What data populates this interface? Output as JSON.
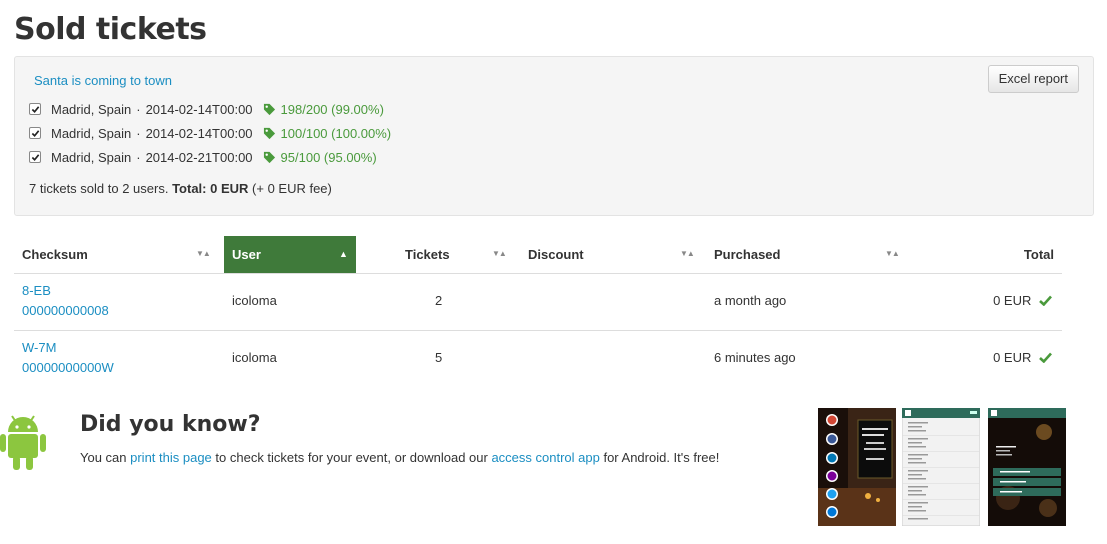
{
  "page": {
    "title": "Sold tickets"
  },
  "event": {
    "name": "Santa is coming to town",
    "excel_button": "Excel report",
    "sessions": [
      {
        "checked": true,
        "location": "Madrid, Spain",
        "separator": "·",
        "datetime": "2014-02-14T00:00",
        "sold": "198/200 (99.00%)"
      },
      {
        "checked": true,
        "location": "Madrid, Spain",
        "separator": "·",
        "datetime": "2014-02-14T00:00",
        "sold": "100/100 (100.00%)"
      },
      {
        "checked": true,
        "location": "Madrid, Spain",
        "separator": "·",
        "datetime": "2014-02-21T00:00",
        "sold": "95/100 (95.00%)"
      }
    ],
    "summary": {
      "prefix": "7 tickets sold to 2 users.",
      "total_label": "Total: 0 EUR",
      "fee": "(+ 0 EUR fee)"
    }
  },
  "table": {
    "columns": [
      {
        "label": "Checksum",
        "sort": "▼▲"
      },
      {
        "label": "User",
        "sort": "▲",
        "active": true
      },
      {
        "label": "Tickets",
        "sort": "▼▲"
      },
      {
        "label": "Discount",
        "sort": "▼▲"
      },
      {
        "label": "Purchased",
        "sort": "▼▲"
      },
      {
        "label": "Total"
      }
    ],
    "rows": [
      {
        "checksum_line1": "8-EB",
        "checksum_line2": "000000000008",
        "user": "icoloma",
        "tickets": "2",
        "discount": "",
        "purchased": "a month ago",
        "total": "0 EUR"
      },
      {
        "checksum_line1": "W-7M",
        "checksum_line2": "00000000000W",
        "user": "icoloma",
        "tickets": "5",
        "discount": "",
        "purchased": "6 minutes ago",
        "total": "0 EUR"
      }
    ]
  },
  "did_you_know": {
    "title": "Did you know?",
    "text_1": "You can ",
    "link_1": "print this page",
    "text_2": " to check tickets for your event, or download our ",
    "link_2": "access control app",
    "text_3": " for Android. It's free!"
  },
  "colors": {
    "accent": "#3f7a3a",
    "link": "#1b8ec2",
    "success": "#4a9a3c"
  },
  "icons": [
    "checkbox-icon",
    "tag-icon",
    "check-icon",
    "sort-icon",
    "android-icon"
  ]
}
